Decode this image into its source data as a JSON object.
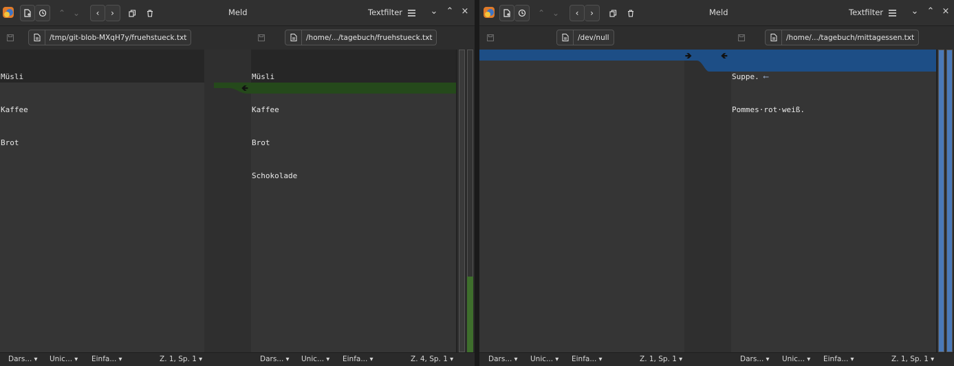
{
  "window_left": {
    "title": "Meld",
    "textfilter": "Textfilter",
    "left_file": {
      "path": "/tmp/git-blob-MXqH7y/fruehstueck.txt",
      "lines": [
        "Müsli",
        "Kaffee",
        "Brot"
      ]
    },
    "right_file": {
      "path": "/home/.../tagebuch/fruehstueck.txt",
      "lines": [
        "Müsli",
        "Kaffee",
        "Brot",
        "Schokolade"
      ]
    },
    "status_left": {
      "view": "Dars...",
      "encoding": "Unic...",
      "insert": "Einfa...",
      "position": "Z. 1, Sp. 1"
    },
    "status_right": {
      "view": "Dars...",
      "encoding": "Unic...",
      "insert": "Einfa...",
      "position": "Z. 4, Sp. 1"
    }
  },
  "window_right": {
    "title": "Meld",
    "textfilter": "Textfilter",
    "left_file": {
      "path": "/dev/null",
      "lines": []
    },
    "right_file": {
      "path": "/home/.../tagebuch/mittagessen.txt",
      "lines": [
        "Suppe.",
        "Pommes·rot·weiß."
      ]
    },
    "status_left": {
      "view": "Dars...",
      "encoding": "Unic...",
      "insert": "Einfa...",
      "position": "Z. 1, Sp. 1"
    },
    "status_right": {
      "view": "Dars...",
      "encoding": "Unic...",
      "insert": "Einfa...",
      "position": "Z. 1, Sp. 1"
    }
  },
  "colors": {
    "insert_green": "#25491b",
    "insert_blue": "#1d4e86",
    "scroll_green": "#3e6e2c",
    "scroll_blue": "#4a79b8"
  },
  "icons": [
    "meld-app-icon",
    "new-comparison-icon",
    "history-icon",
    "previous-change-icon",
    "next-change-icon",
    "previous-conflict-icon",
    "next-conflict-icon",
    "copy-icon",
    "delete-icon",
    "hamburger-menu-icon",
    "minimize-icon",
    "maximize-icon",
    "close-icon",
    "save-icon",
    "file-icon",
    "push-right-arrow-icon",
    "push-left-arrow-icon",
    "chevron-down-icon"
  ]
}
